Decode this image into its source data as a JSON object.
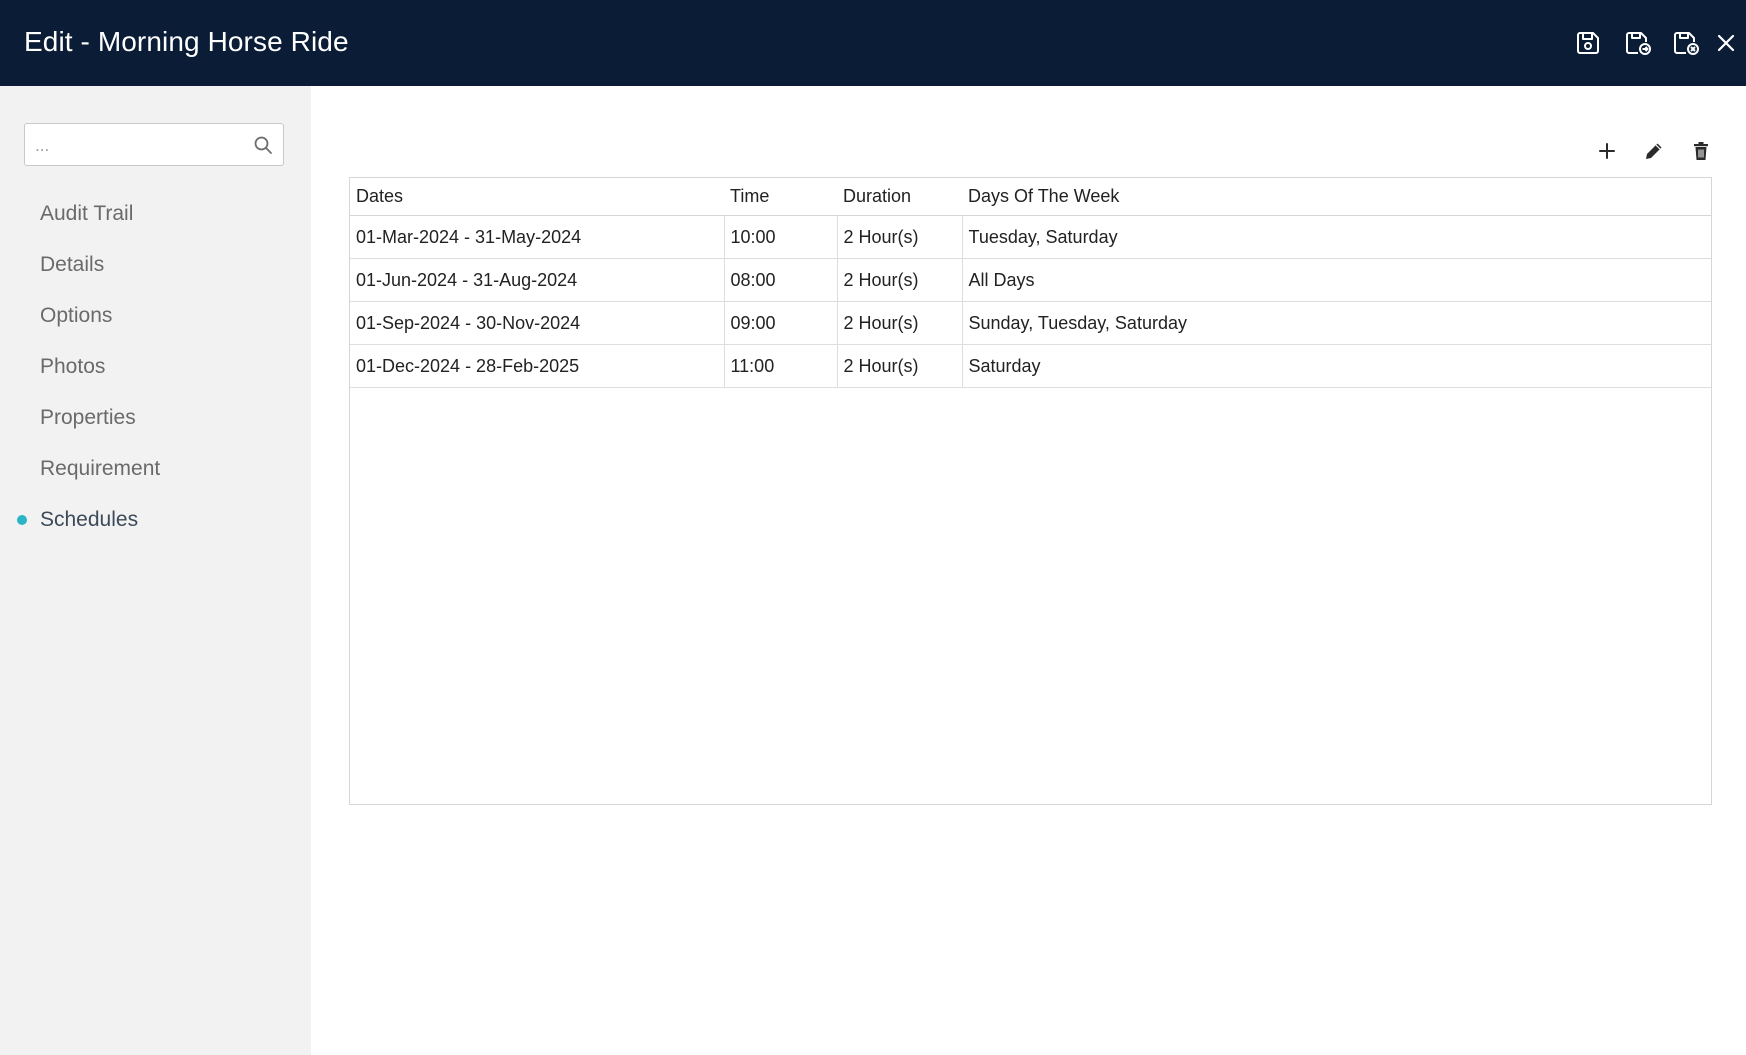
{
  "window": {
    "title": "Edit - Morning Horse Ride"
  },
  "header_actions": [
    {
      "name": "save-button",
      "icon": "save-icon",
      "tooltip": ""
    },
    {
      "name": "save-and-exit-button",
      "icon": "save-and-exit-icon",
      "tooltip": ""
    },
    {
      "name": "save-and-close-button",
      "icon": "save-cancel-icon",
      "tooltip": ""
    },
    {
      "name": "close-button",
      "icon": "close-icon",
      "tooltip": ""
    }
  ],
  "search": {
    "placeholder": "...",
    "value": ""
  },
  "sidebar": {
    "items": [
      {
        "label": "Audit Trail",
        "active": false
      },
      {
        "label": "Details",
        "active": false
      },
      {
        "label": "Options",
        "active": false
      },
      {
        "label": "Photos",
        "active": false
      },
      {
        "label": "Properties",
        "active": false
      },
      {
        "label": "Requirement",
        "active": false
      },
      {
        "label": "Schedules",
        "active": true
      }
    ],
    "active_indicator_color": "#2bb3c8"
  },
  "toolbar": {
    "icons": [
      "plus-icon",
      "pencil-icon",
      "trash-icon"
    ]
  },
  "table": {
    "columns": [
      "Dates",
      "Time",
      "Duration",
      "Days Of The Week"
    ],
    "rows": [
      [
        "01-Mar-2024 - 31-May-2024",
        "10:00",
        "2 Hour(s)",
        "Tuesday, Saturday"
      ],
      [
        "01-Jun-2024 - 31-Aug-2024",
        "08:00",
        "2 Hour(s)",
        "All Days"
      ],
      [
        "01-Sep-2024 - 30-Nov-2024",
        "09:00",
        "2 Hour(s)",
        "Sunday, Tuesday, Saturday"
      ],
      [
        "01-Dec-2024 - 28-Feb-2025",
        "11:00",
        "2 Hour(s)",
        "Saturday"
      ]
    ]
  },
  "colors": {
    "header_bg": "#0b1d36",
    "sidebar_bg": "#f2f2f2",
    "accent": "#2bb3c8"
  }
}
